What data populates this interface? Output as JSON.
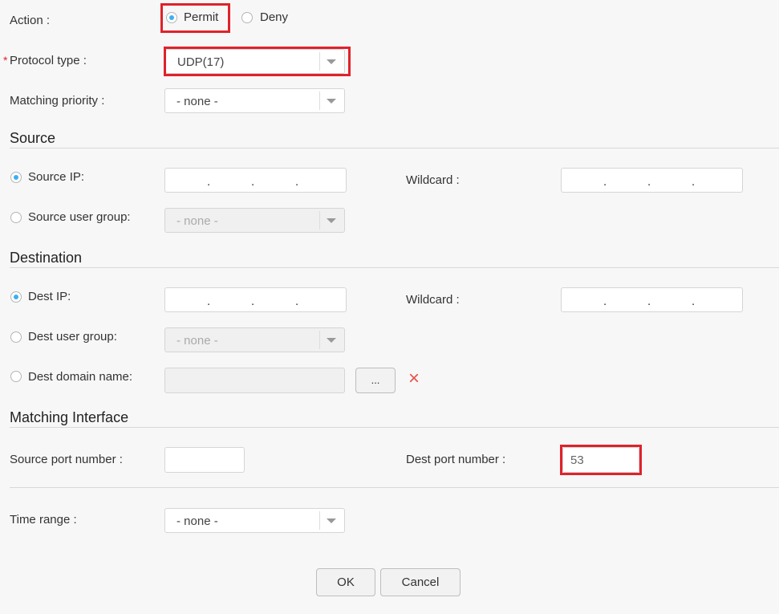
{
  "action": {
    "label": "Action :",
    "permit": "Permit",
    "deny": "Deny",
    "selected": "Permit"
  },
  "protocol": {
    "required_mark": "*",
    "label": "Protocol type :",
    "value": "UDP(17)"
  },
  "priority": {
    "label": "Matching priority :",
    "value": "- none -"
  },
  "source": {
    "title": "Source",
    "ip_label": "Source IP:",
    "wildcard_label": "Wildcard :",
    "user_group_label": "Source user group:",
    "user_group_value": "- none -",
    "dot": "."
  },
  "destination": {
    "title": "Destination",
    "ip_label": "Dest IP:",
    "wildcard_label": "Wildcard :",
    "user_group_label": "Dest user group:",
    "user_group_value": "- none -",
    "domain_label": "Dest domain name:",
    "browse_label": "...",
    "clear_icon": "×"
  },
  "matching_interface": {
    "title": "Matching Interface",
    "source_port_label": "Source port number :",
    "source_port_value": "",
    "dest_port_label": "Dest port number :",
    "dest_port_value": "53"
  },
  "time_range": {
    "label": "Time range :",
    "value": "- none -"
  },
  "buttons": {
    "ok": "OK",
    "cancel": "Cancel"
  },
  "colors": {
    "highlight": "#e0222a",
    "radio_selected": "#3ab0f0",
    "clear_icon": "#e8524a"
  }
}
